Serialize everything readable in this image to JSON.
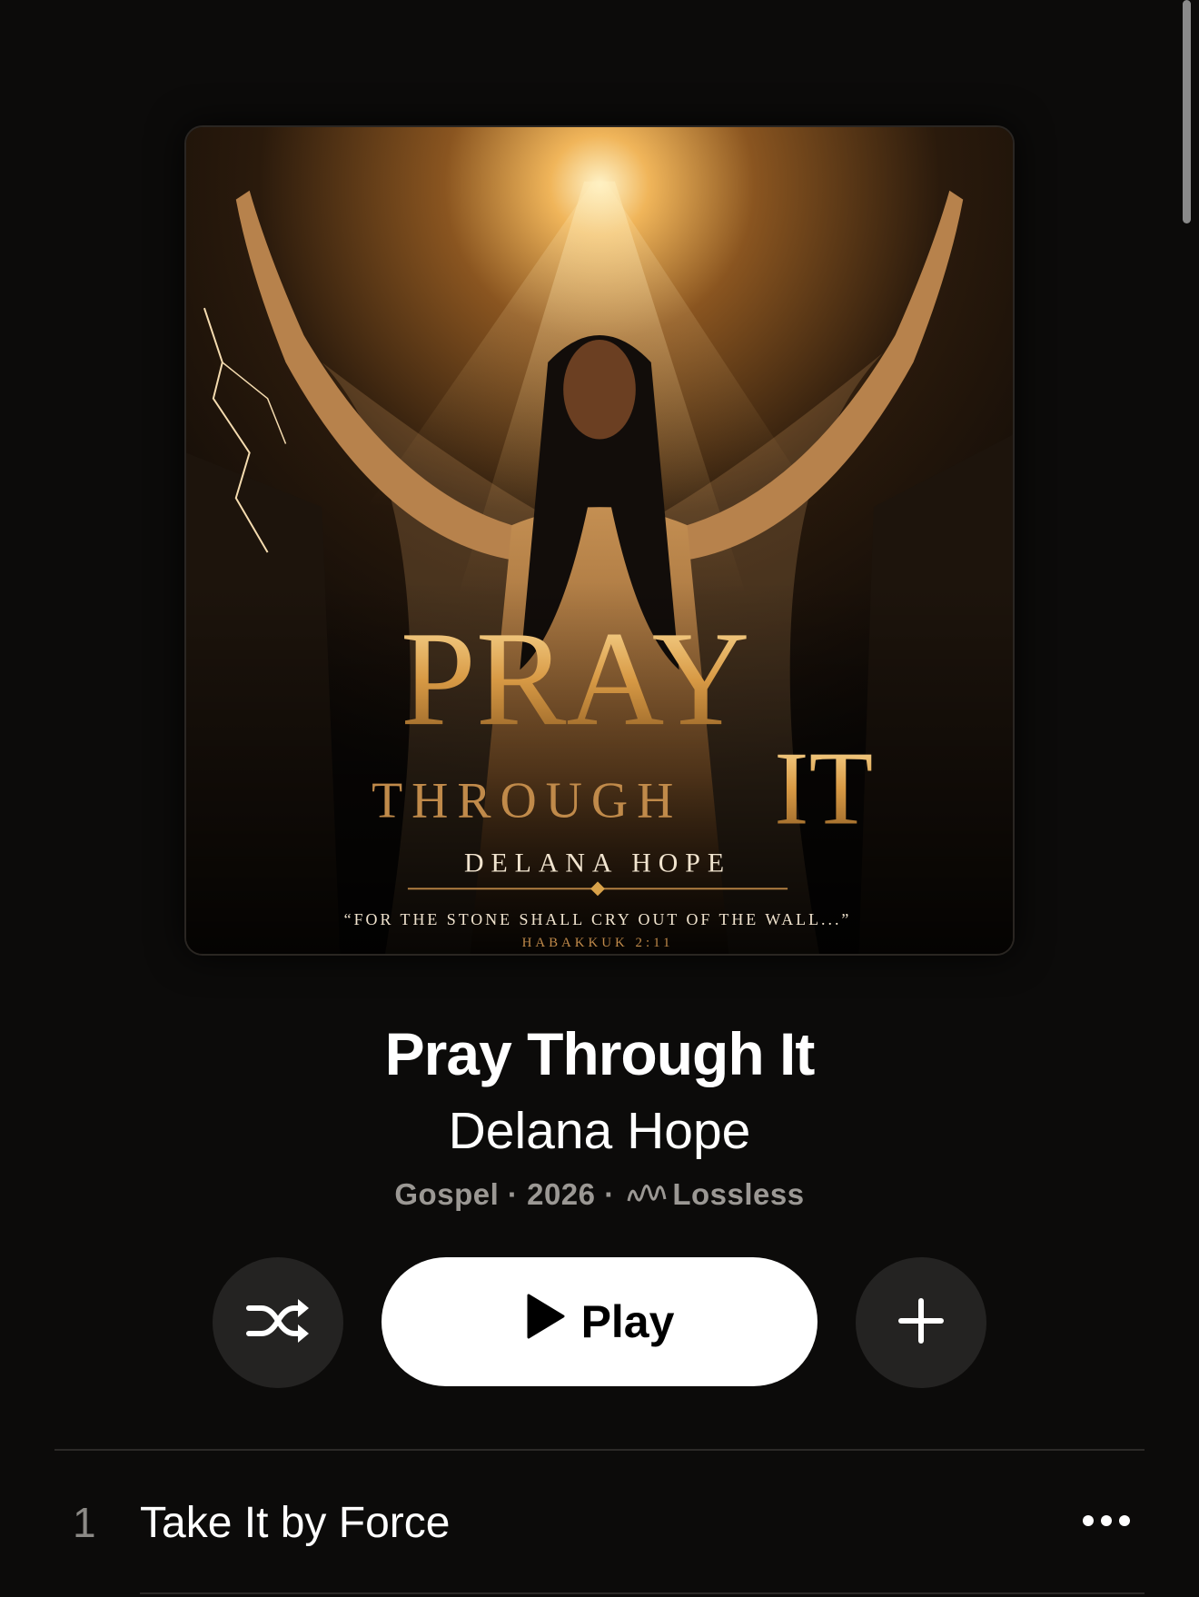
{
  "album": {
    "cover_title_line1": "PRAY",
    "cover_title_line2": "THROUGH",
    "cover_title_it": "IT",
    "cover_artist": "DELANA HOPE",
    "cover_quote": "“FOR THE STONE SHALL CRY OUT OF THE WALL...”",
    "cover_reference": "HABAKKUK 2:11",
    "title": "Pray Through It",
    "artist": "Delana Hope",
    "genre": "Gospel",
    "year": "2026",
    "quality": "Lossless",
    "separator": "·"
  },
  "actions": {
    "shuffle_icon": "shuffle-icon",
    "play_label": "Play",
    "add_icon": "plus-icon"
  },
  "tracks": [
    {
      "number": "1",
      "title": "Take It by Force"
    }
  ],
  "colors": {
    "background": "#0c0b0a",
    "meta_text": "#9b9894",
    "button_dark": "#242322",
    "play_button": "#ffffff",
    "gold": "#d9a24a"
  }
}
